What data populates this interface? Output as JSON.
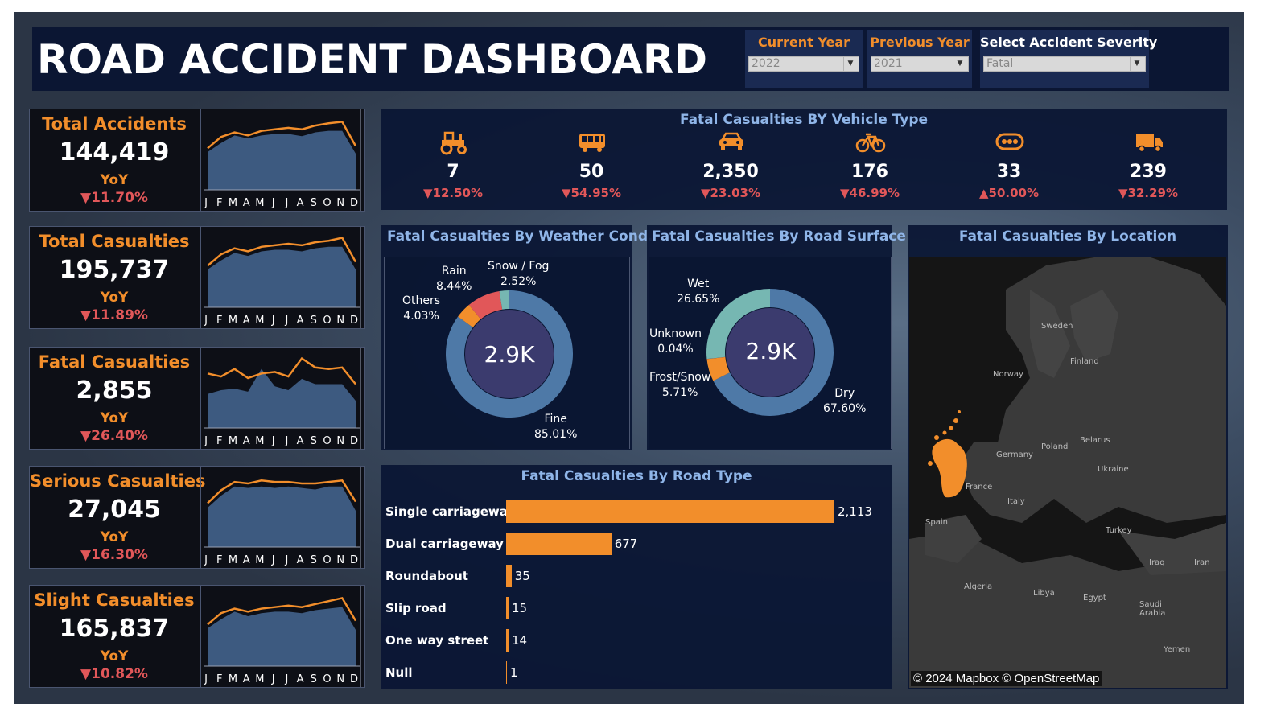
{
  "header": {
    "title": "ROAD ACCIDENT DASHBOARD"
  },
  "filters": [
    {
      "label": "Current Year",
      "value": "2022"
    },
    {
      "label": "Previous Year",
      "value": "2021"
    },
    {
      "label": "Select Accident Severity",
      "value": "Fatal"
    }
  ],
  "kpis": [
    {
      "name": "Total Accidents",
      "value": "144,419",
      "yoy": "YoY",
      "change": "▼11.70%"
    },
    {
      "name": "Total Casualties",
      "value": "195,737",
      "yoy": "YoY",
      "change": "▼11.89%"
    },
    {
      "name": "Fatal Casualties",
      "value": "2,855",
      "yoy": "YoY",
      "change": "▼26.40%"
    },
    {
      "name": "Serious Casualties",
      "value": "27,045",
      "yoy": "YoY",
      "change": "▼16.30%"
    },
    {
      "name": "Slight Casualties",
      "value": "165,837",
      "yoy": "YoY",
      "change": "▼10.82%"
    }
  ],
  "colors": {
    "accent": "#f28e2b",
    "down": "#e15759",
    "area": "#3d5a80",
    "panel": "#0b1633",
    "title": "#8fb5e8"
  },
  "chart_data": [
    {
      "type": "area",
      "title": "Total Accidents",
      "categories": [
        "J",
        "F",
        "M",
        "A",
        "M",
        "J",
        "J",
        "A",
        "S",
        "O",
        "N",
        "D"
      ],
      "series": [
        {
          "values": [
            0.55,
            0.7,
            0.76,
            0.72,
            0.78,
            0.8,
            0.82,
            0.8,
            0.85,
            0.88,
            0.9,
            0.58
          ]
        },
        {
          "values": [
            0.5,
            0.62,
            0.72,
            0.68,
            0.72,
            0.74,
            0.74,
            0.71,
            0.76,
            0.78,
            0.78,
            0.48
          ]
        }
      ]
    },
    {
      "type": "area",
      "title": "Total Casualties",
      "categories": [
        "J",
        "F",
        "M",
        "A",
        "M",
        "J",
        "J",
        "A",
        "S",
        "O",
        "N",
        "D"
      ],
      "series": [
        {
          "values": [
            0.55,
            0.7,
            0.78,
            0.74,
            0.8,
            0.82,
            0.84,
            0.82,
            0.86,
            0.88,
            0.92,
            0.6
          ]
        },
        {
          "values": [
            0.5,
            0.62,
            0.72,
            0.68,
            0.74,
            0.76,
            0.76,
            0.74,
            0.78,
            0.8,
            0.8,
            0.5
          ]
        }
      ]
    },
    {
      "type": "area",
      "title": "Fatal Casualties",
      "categories": [
        "J",
        "F",
        "M",
        "A",
        "M",
        "J",
        "J",
        "A",
        "S",
        "O",
        "N",
        "D"
      ],
      "series": [
        {
          "values": [
            0.72,
            0.68,
            0.78,
            0.66,
            0.72,
            0.74,
            0.68,
            0.92,
            0.8,
            0.78,
            0.8,
            0.58
          ]
        },
        {
          "values": [
            0.45,
            0.5,
            0.52,
            0.48,
            0.78,
            0.55,
            0.5,
            0.65,
            0.58,
            0.58,
            0.58,
            0.36
          ]
        }
      ]
    },
    {
      "type": "area",
      "title": "Serious Casualties",
      "categories": [
        "J",
        "F",
        "M",
        "A",
        "M",
        "J",
        "J",
        "A",
        "S",
        "O",
        "N",
        "D"
      ],
      "series": [
        {
          "values": [
            0.58,
            0.75,
            0.86,
            0.84,
            0.88,
            0.86,
            0.86,
            0.84,
            0.84,
            0.86,
            0.88,
            0.6
          ]
        },
        {
          "values": [
            0.52,
            0.68,
            0.8,
            0.78,
            0.8,
            0.78,
            0.8,
            0.78,
            0.76,
            0.8,
            0.8,
            0.48
          ]
        }
      ]
    },
    {
      "type": "area",
      "title": "Slight Casualties",
      "categories": [
        "J",
        "F",
        "M",
        "A",
        "M",
        "J",
        "J",
        "A",
        "S",
        "O",
        "N",
        "D"
      ],
      "series": [
        {
          "values": [
            0.55,
            0.7,
            0.76,
            0.72,
            0.76,
            0.78,
            0.8,
            0.78,
            0.82,
            0.86,
            0.9,
            0.6
          ]
        },
        {
          "values": [
            0.5,
            0.62,
            0.72,
            0.66,
            0.7,
            0.72,
            0.72,
            0.7,
            0.74,
            0.76,
            0.78,
            0.48
          ]
        }
      ]
    },
    {
      "type": "table",
      "title": "Fatal Casualties BY Vehicle Type",
      "items": [
        {
          "icon": "tractor-icon",
          "value": "7",
          "change": "▼12.50%"
        },
        {
          "icon": "bus-icon",
          "value": "50",
          "change": "▼54.95%"
        },
        {
          "icon": "car-icon",
          "value": "2,350",
          "change": "▼23.03%"
        },
        {
          "icon": "bicycle-icon",
          "value": "176",
          "change": "▼46.99%"
        },
        {
          "icon": "other-vehicle-icon",
          "value": "33",
          "change": "▲50.00%"
        },
        {
          "icon": "van-icon",
          "value": "239",
          "change": "▼32.29%"
        }
      ]
    },
    {
      "type": "pie",
      "title": "Fatal Casualties By Weather Cond.",
      "center": "2.9K",
      "slices": [
        {
          "name": "Fine",
          "pct": "85.01%",
          "value": 85.01,
          "color": "#4e79a7"
        },
        {
          "name": "Others",
          "pct": "4.03%",
          "value": 4.03,
          "color": "#f28e2b"
        },
        {
          "name": "Rain",
          "pct": "8.44%",
          "value": 8.44,
          "color": "#e15759"
        },
        {
          "name": "Snow / Fog",
          "pct": "2.52%",
          "value": 2.52,
          "color": "#76b7b2"
        }
      ]
    },
    {
      "type": "pie",
      "title": "Fatal Casualties By Road Surface",
      "center": "2.9K",
      "slices": [
        {
          "name": "Dry",
          "pct": "67.60%",
          "value": 67.6,
          "color": "#4e79a7"
        },
        {
          "name": "Frost/Snow",
          "pct": "5.71%",
          "value": 5.71,
          "color": "#f28e2b"
        },
        {
          "name": "Unknown",
          "pct": "0.04%",
          "value": 0.04,
          "color": "#e15759"
        },
        {
          "name": "Wet",
          "pct": "26.65%",
          "value": 26.65,
          "color": "#76b7b2"
        }
      ]
    },
    {
      "type": "bar",
      "title": "Fatal Casualties By Road Type",
      "categories": [
        "Single carriageway",
        "Dual carriageway",
        "Roundabout",
        "Slip road",
        "One way street",
        "Null"
      ],
      "values": [
        2113,
        677,
        35,
        15,
        14,
        1
      ],
      "labels": [
        "2,113",
        "677",
        "35",
        "15",
        "14",
        "1"
      ]
    }
  ],
  "map": {
    "title": "Fatal Casualties By Location",
    "attribution": "© 2024 Mapbox © OpenStreetMap",
    "labels": [
      "Sweden",
      "Finland",
      "Norway",
      "Belarus",
      "Poland",
      "Germany",
      "Ukraine",
      "France",
      "Italy",
      "Spain",
      "Turkey",
      "Iraq",
      "Iran",
      "Algeria",
      "Libya",
      "Egypt",
      "Saudi Arabia",
      "Yemen"
    ]
  }
}
